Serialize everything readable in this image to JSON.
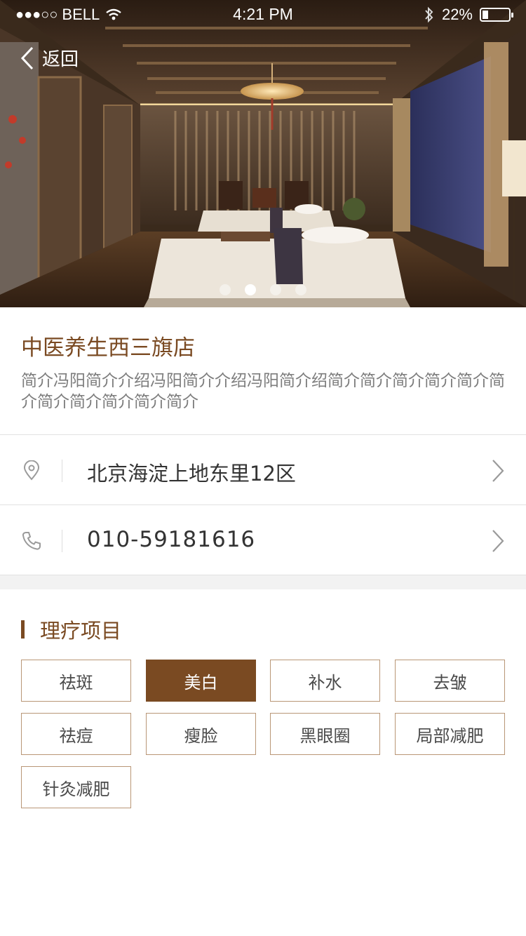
{
  "status_bar": {
    "signal_dots": "●●●○○",
    "carrier": "BELL",
    "time": "4:21 PM",
    "battery": "22%"
  },
  "nav": {
    "back_label": "返回"
  },
  "carousel": {
    "page_count": 4,
    "active_index": 1
  },
  "store": {
    "name": "中医养生西三旗店",
    "description": "简介冯阳简介介绍冯阳简介介绍冯阳简介绍简介简介简介简介简介简介简介简介简介简介简介"
  },
  "address": {
    "icon": "location-pin-icon",
    "text": "北京海淀上地东里12区"
  },
  "phone": {
    "icon": "phone-icon",
    "text": "010-59181616"
  },
  "section": {
    "title": "理疗项目"
  },
  "tags": [
    {
      "label": "祛斑",
      "active": false
    },
    {
      "label": "美白",
      "active": true
    },
    {
      "label": "补水",
      "active": false
    },
    {
      "label": "去皱",
      "active": false
    },
    {
      "label": "祛痘",
      "active": false
    },
    {
      "label": "瘦脸",
      "active": false
    },
    {
      "label": "黑眼圈",
      "active": false
    },
    {
      "label": "局部减肥",
      "active": false
    },
    {
      "label": "针灸减肥",
      "active": false
    }
  ],
  "colors": {
    "accent": "#7a4a22",
    "tag_border": "#b99676"
  }
}
